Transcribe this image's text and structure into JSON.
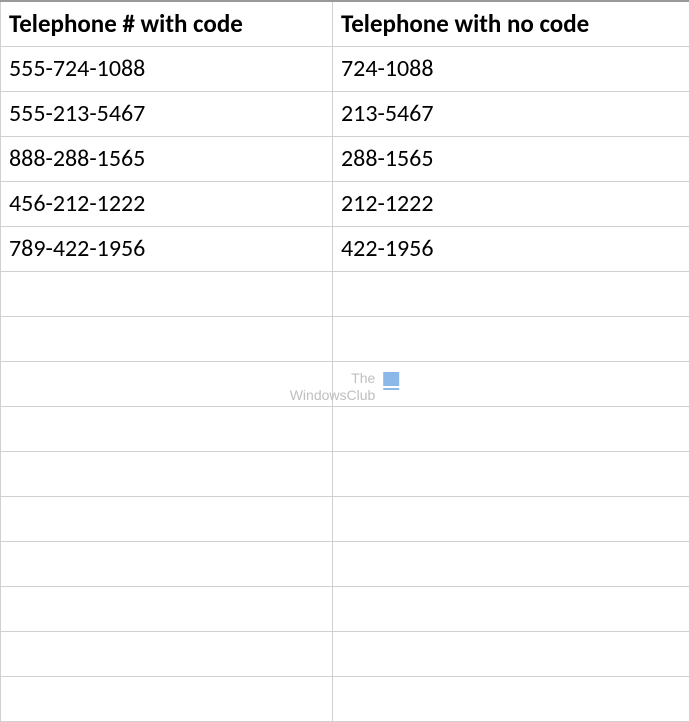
{
  "headers": {
    "col_a": "Telephone # with code",
    "col_b": "Telephone with no code"
  },
  "rows": [
    {
      "a": "555-724-1088",
      "b": "724-1088"
    },
    {
      "a": "555-213-5467",
      "b": "213-5467"
    },
    {
      "a": "888-288-1565",
      "b": "288-1565"
    },
    {
      "a": "456-212-1222",
      "b": "212-1222"
    },
    {
      "a": "789-422-1956",
      "b": "422-1956"
    },
    {
      "a": "",
      "b": ""
    },
    {
      "a": "",
      "b": ""
    },
    {
      "a": "",
      "b": ""
    },
    {
      "a": "",
      "b": ""
    },
    {
      "a": "",
      "b": ""
    },
    {
      "a": "",
      "b": ""
    },
    {
      "a": "",
      "b": ""
    },
    {
      "a": "",
      "b": ""
    },
    {
      "a": "",
      "b": ""
    },
    {
      "a": "",
      "b": ""
    }
  ],
  "watermark": {
    "line1": "The",
    "line2": "WindowsClub"
  },
  "chart_data": {
    "type": "table",
    "title": "",
    "columns": [
      "Telephone # with code",
      "Telephone with no code"
    ],
    "data": [
      [
        "555-724-1088",
        "724-1088"
      ],
      [
        "555-213-5467",
        "213-5467"
      ],
      [
        "888-288-1565",
        "288-1565"
      ],
      [
        "456-212-1222",
        "212-1222"
      ],
      [
        "789-422-1956",
        "422-1956"
      ]
    ]
  }
}
